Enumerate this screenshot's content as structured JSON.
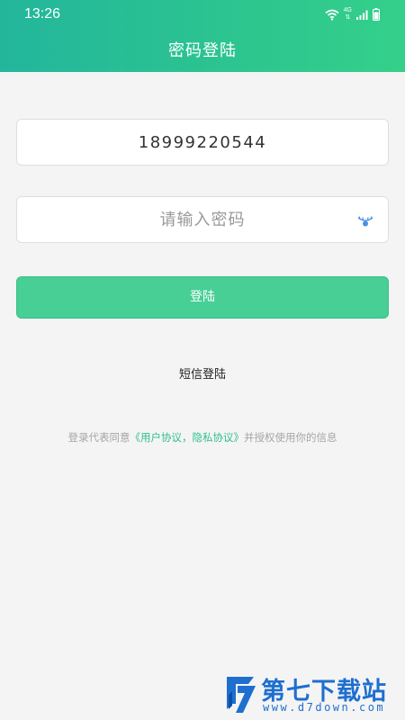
{
  "status_bar": {
    "time": "13:26",
    "network": "4G"
  },
  "header": {
    "title": "密码登陆"
  },
  "form": {
    "phone_value": "18999220544",
    "password_placeholder": "请输入密码"
  },
  "login_button": {
    "label": "登陆"
  },
  "sms_login": {
    "label": "短信登陆"
  },
  "agreement": {
    "prefix": "登录代表同意",
    "link": "《用户协议，隐私协议》",
    "suffix": "并授权使用你的信息"
  },
  "watermark": {
    "name": "第七下载站",
    "url": "www.d7down.com"
  },
  "colors": {
    "header_gradient_start": "#23b69c",
    "header_gradient_end": "#34d08a",
    "button": "#47cf96",
    "link": "#2fbf8c",
    "background": "#f4f4f4",
    "watermark": "#1e6fd0"
  },
  "icons": [
    "wifi-icon",
    "signal-icon",
    "battery-icon",
    "eye-icon"
  ]
}
